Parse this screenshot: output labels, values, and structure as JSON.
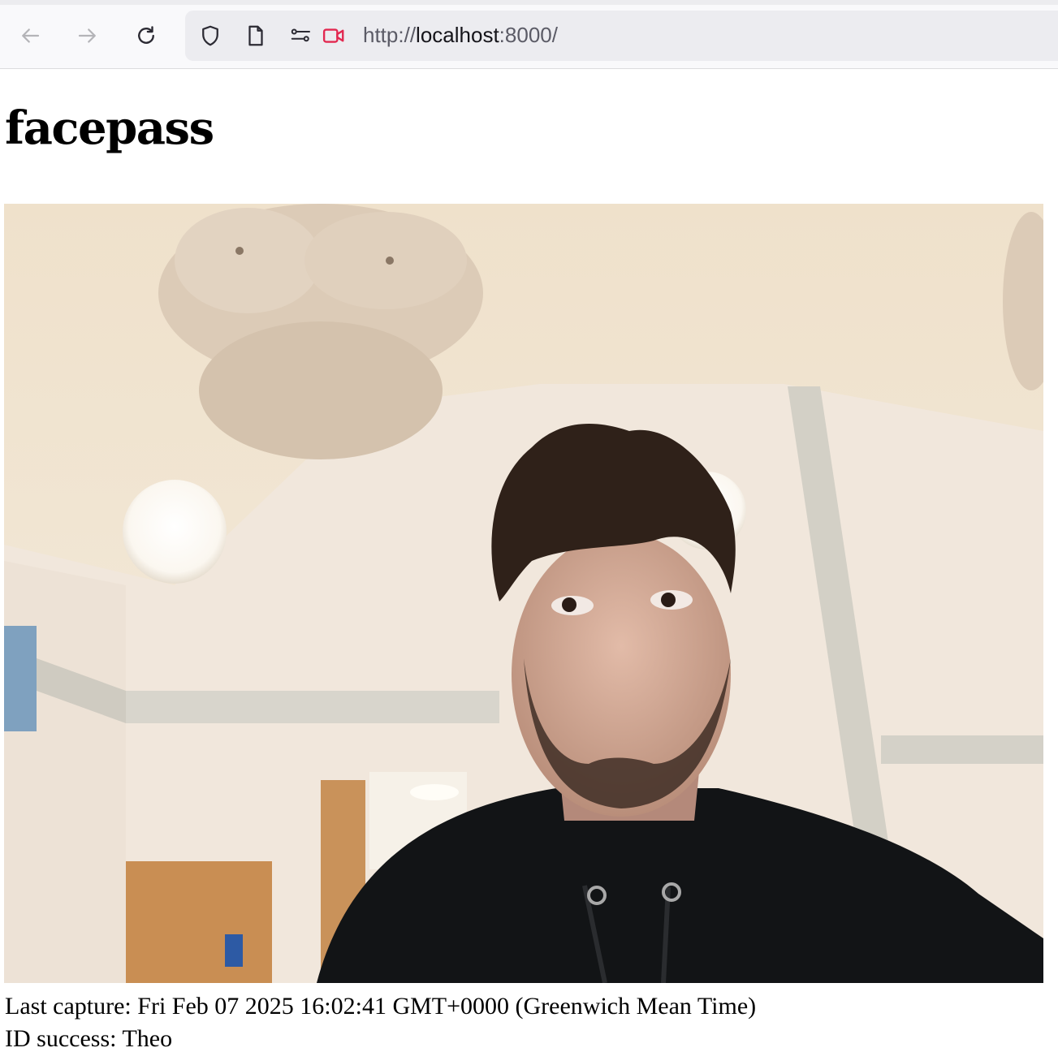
{
  "browser": {
    "url_scheme": "http://",
    "url_host": "localhost",
    "url_rest": ":8000/",
    "icons": [
      "back-arrow-icon",
      "forward-arrow-icon",
      "reload-icon",
      "shield-icon",
      "page-icon",
      "permissions-icon",
      "camera-in-use-icon"
    ],
    "camera_indicator_color": "#e22850"
  },
  "page": {
    "title": "facepass",
    "capture_label": "Last capture:",
    "capture_time": "Fri Feb 07 2025 16:02:41 GMT+0000 (Greenwich Mean Time)",
    "id_label": "ID success:",
    "id_name": "Theo"
  }
}
